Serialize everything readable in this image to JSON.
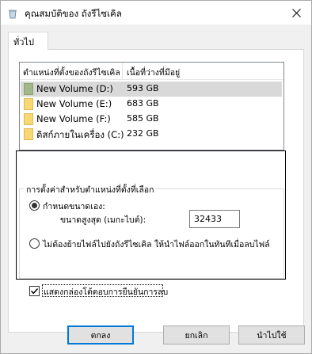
{
  "window": {
    "title": "คุณสมบัติของ ถังรีไซเคิล",
    "close_label": "✕"
  },
  "tabs": [
    {
      "label": "ทั่วไป",
      "active": true
    }
  ],
  "locations_list": {
    "columns": [
      "ตำแหน่งที่ตั้งของถังรีไซเคิล",
      "เนื้อที่ว่างที่มีอยู่"
    ],
    "rows": [
      {
        "name": "New Volume (D:)",
        "size": "593 GB",
        "selected": true,
        "icon": "drive-folder-icon"
      },
      {
        "name": "New Volume (E:)",
        "size": "683 GB",
        "selected": false,
        "icon": "drive-folder-icon"
      },
      {
        "name": "New Volume (F:)",
        "size": "585 GB",
        "selected": false,
        "icon": "drive-folder-icon"
      },
      {
        "name": "ดิสก์ภายในเครื่อง (C:)",
        "size": "232 GB",
        "selected": false,
        "icon": "drive-folder-icon"
      }
    ]
  },
  "settings": {
    "group_title": "การตั้งค่าสำหรับตำแหน่งที่ตั้งที่เลือก",
    "custom_size": {
      "label_line1": "กำหนดขนาดเอง:",
      "label_line2": "ขนาดสูงสุด (เมกะไบต์):",
      "value": "32433",
      "selected": true
    },
    "no_recycle": {
      "label": "ไม่ต้องย้ายไฟล์ไปยังถังรีไซเคิล ให้นำไฟล์ออกในทันทีเมื่อลบไฟล์",
      "selected": false
    },
    "confirm_delete": {
      "label": "แสดงกล่องโต้ตอบการยืนยันการลบ",
      "checked": true
    }
  },
  "buttons": {
    "ok": "ตกลง",
    "cancel": "ยกเลิก",
    "apply": "นำไปใช้"
  },
  "colors": {
    "selected_row": "#d9d9d9",
    "default_button_border": "#0078d7",
    "window_bg": "#f0f0f0"
  }
}
